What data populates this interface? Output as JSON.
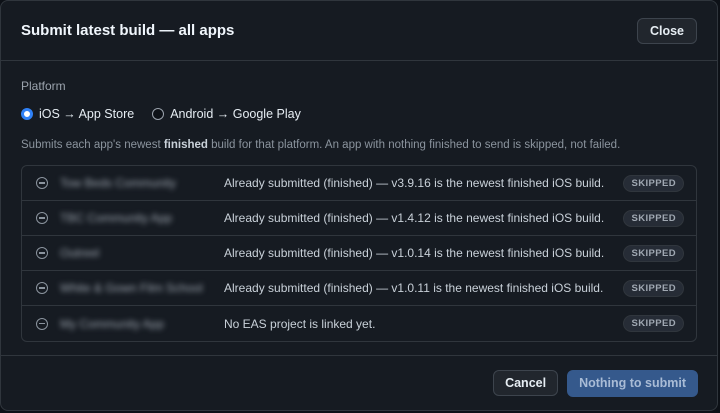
{
  "dialog": {
    "title": "Submit latest build — all apps",
    "close_label": "Close"
  },
  "platform": {
    "label": "Platform",
    "options": [
      {
        "label": "iOS → App Store",
        "selected": true
      },
      {
        "label": "Android → Google Play",
        "selected": false
      }
    ]
  },
  "description": {
    "before": "Submits each app's newest ",
    "bold": "finished",
    "after": " build for that platform. An app with nothing finished to send is skipped, not failed."
  },
  "apps": [
    {
      "name": "Tow Beds Community",
      "status": "Already submitted (finished) — v3.9.16 is the newest finished iOS build.",
      "badge": "SKIPPED"
    },
    {
      "name": "TBC Community App",
      "status": "Already submitted (finished) — v1.4.12 is the newest finished iOS build.",
      "badge": "SKIPPED"
    },
    {
      "name": "Outreel",
      "status": "Already submitted (finished) — v1.0.14 is the newest finished iOS build.",
      "badge": "SKIPPED"
    },
    {
      "name": "White & Gown Film School",
      "status": "Already submitted (finished) — v1.0.11 is the newest finished iOS build.",
      "badge": "SKIPPED"
    },
    {
      "name": "My Community App",
      "status": "No EAS project is linked yet.",
      "badge": "SKIPPED"
    }
  ],
  "footer": {
    "cancel_label": "Cancel",
    "submit_label": "Nothing to submit"
  },
  "colors": {
    "accent": "#2f81f7",
    "background": "#161b22",
    "border": "#30363d",
    "submit_disabled": "#35598c"
  }
}
